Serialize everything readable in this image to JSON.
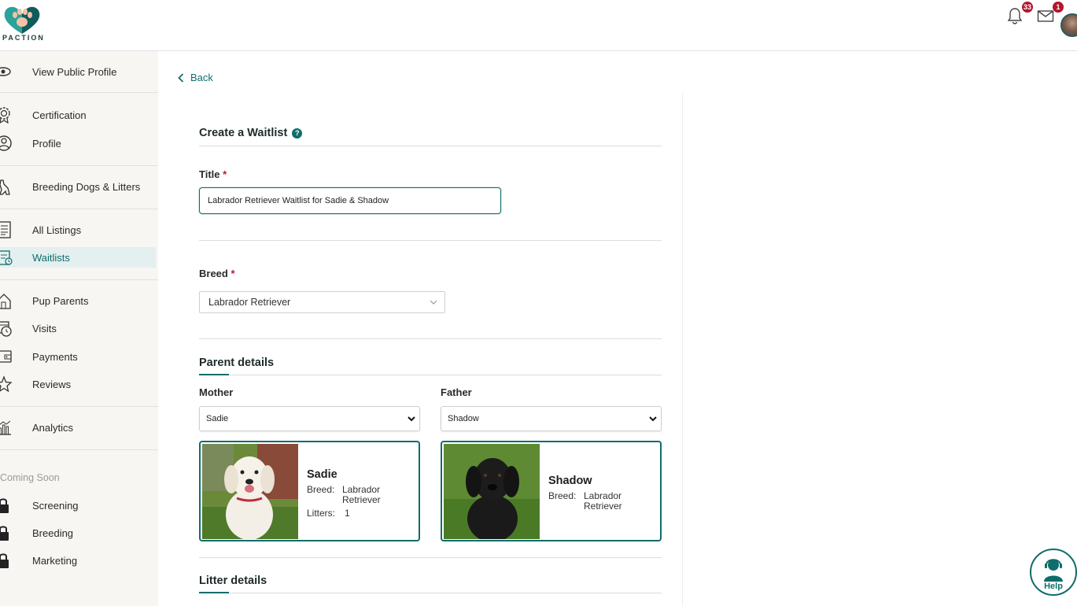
{
  "brand": {
    "logo_text": "PACTION",
    "accent": "#0f6d6b",
    "badge_color": "#b3162c"
  },
  "header": {
    "notifications_count": "33",
    "messages_count": "1"
  },
  "sidebar": {
    "items": [
      {
        "label": "View Public Profile",
        "icon": "eye-icon"
      },
      {
        "label": "Certification",
        "icon": "certificate-badge-icon"
      },
      {
        "label": "Profile",
        "icon": "user-circle-icon"
      },
      {
        "label": "Breeding Dogs & Litters",
        "icon": "dog-icon"
      },
      {
        "label": "All Listings",
        "icon": "listing-icon"
      },
      {
        "label": "Waitlists",
        "icon": "waitlist-icon"
      },
      {
        "label": "Pup Parents",
        "icon": "house-icon"
      },
      {
        "label": "Visits",
        "icon": "calendar-clock-icon"
      },
      {
        "label": "Payments",
        "icon": "wallet-icon"
      },
      {
        "label": "Reviews",
        "icon": "star-icon"
      },
      {
        "label": "Analytics",
        "icon": "chart-icon"
      }
    ],
    "coming_soon_label": "Coming Soon",
    "locked_items": [
      {
        "label": "Screening",
        "icon": "lock-icon"
      },
      {
        "label": "Breeding",
        "icon": "lock-icon"
      },
      {
        "label": "Marketing",
        "icon": "lock-icon"
      }
    ]
  },
  "back_label": "Back",
  "form": {
    "heading": "Create a Waitlist",
    "help_symbol": "?",
    "title_label": "Title",
    "required_mark": "*",
    "title_value": "Labrador Retriever Waitlist for Sadie & Shadow",
    "breed_label": "Breed",
    "breed_value": "Labrador Retriever",
    "parent_details_heading": "Parent details",
    "mother_label": "Mother",
    "mother_value": "Sadie",
    "father_label": "Father",
    "father_value": "Shadow",
    "litter_details_heading": "Litter details"
  },
  "mother_card": {
    "name": "Sadie",
    "breed_key": "Breed:",
    "breed_value": "Labrador Retriever",
    "litters_key": "Litters:",
    "litters_value": "1"
  },
  "father_card": {
    "name": "Shadow",
    "breed_key": "Breed:",
    "breed_value": "Labrador Retriever"
  },
  "help_button_label": "Help"
}
